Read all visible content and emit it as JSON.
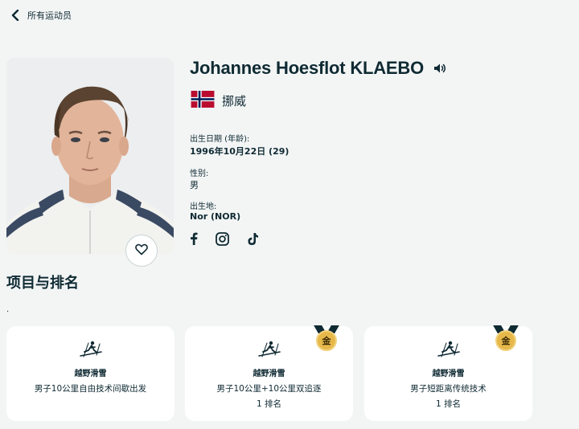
{
  "nav": {
    "back_label": "所有运动员"
  },
  "athlete": {
    "name": "Johannes Hoesflot KLAEBO",
    "country": "挪威",
    "birth_label": "出生日期 (年龄):",
    "birth_value": "1996年10月22日 (29)",
    "gender_label": "性别:",
    "gender_value": "男",
    "birthplace_label": "出生地:",
    "birthplace_value": "Nor (NOR)"
  },
  "socials": [
    "facebook-icon",
    "instagram-icon",
    "tiktok-icon"
  ],
  "events_section": {
    "title": "项目与排名",
    "note": ".",
    "cards": [
      {
        "sport": "越野滑雪",
        "event": "男子10公里自由技术间歇出发",
        "rank": "",
        "medal": ""
      },
      {
        "sport": "越野滑雪",
        "event": "男子10公里+10公里双追逐",
        "rank": "1 排名",
        "medal": "金"
      },
      {
        "sport": "越野滑雪",
        "event": "男子短距离传统技术",
        "rank": "1 排名",
        "medal": "金"
      }
    ]
  },
  "colors": {
    "background": "#f3f5f5",
    "text": "#0f2a33",
    "gold": "#e6b84a",
    "norway_red": "#ba0c2f",
    "norway_blue": "#00205b"
  }
}
